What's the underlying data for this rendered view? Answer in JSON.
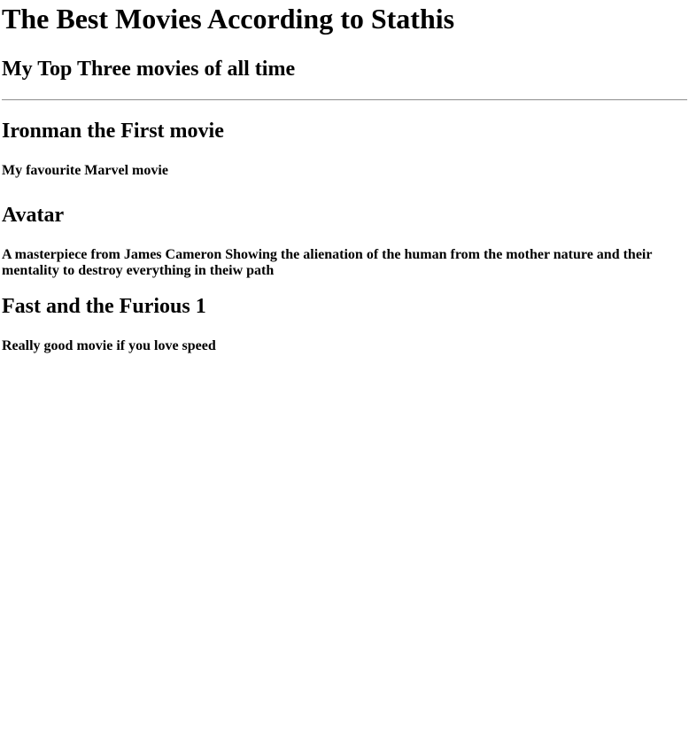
{
  "page": {
    "title": "The Best Movies According to Stathis",
    "subtitle": "My Top Three movies of all time"
  },
  "movies": [
    {
      "title": "Ironman the First movie",
      "description": "My favourite Marvel movie"
    },
    {
      "title": "Avatar",
      "description": "A masterpiece from James Cameron Showing the alienation of the human from the mother nature and their mentality to destroy everything in theiw path"
    },
    {
      "title": "Fast and the Furious 1",
      "description": "Really good movie if you love speed"
    }
  ]
}
